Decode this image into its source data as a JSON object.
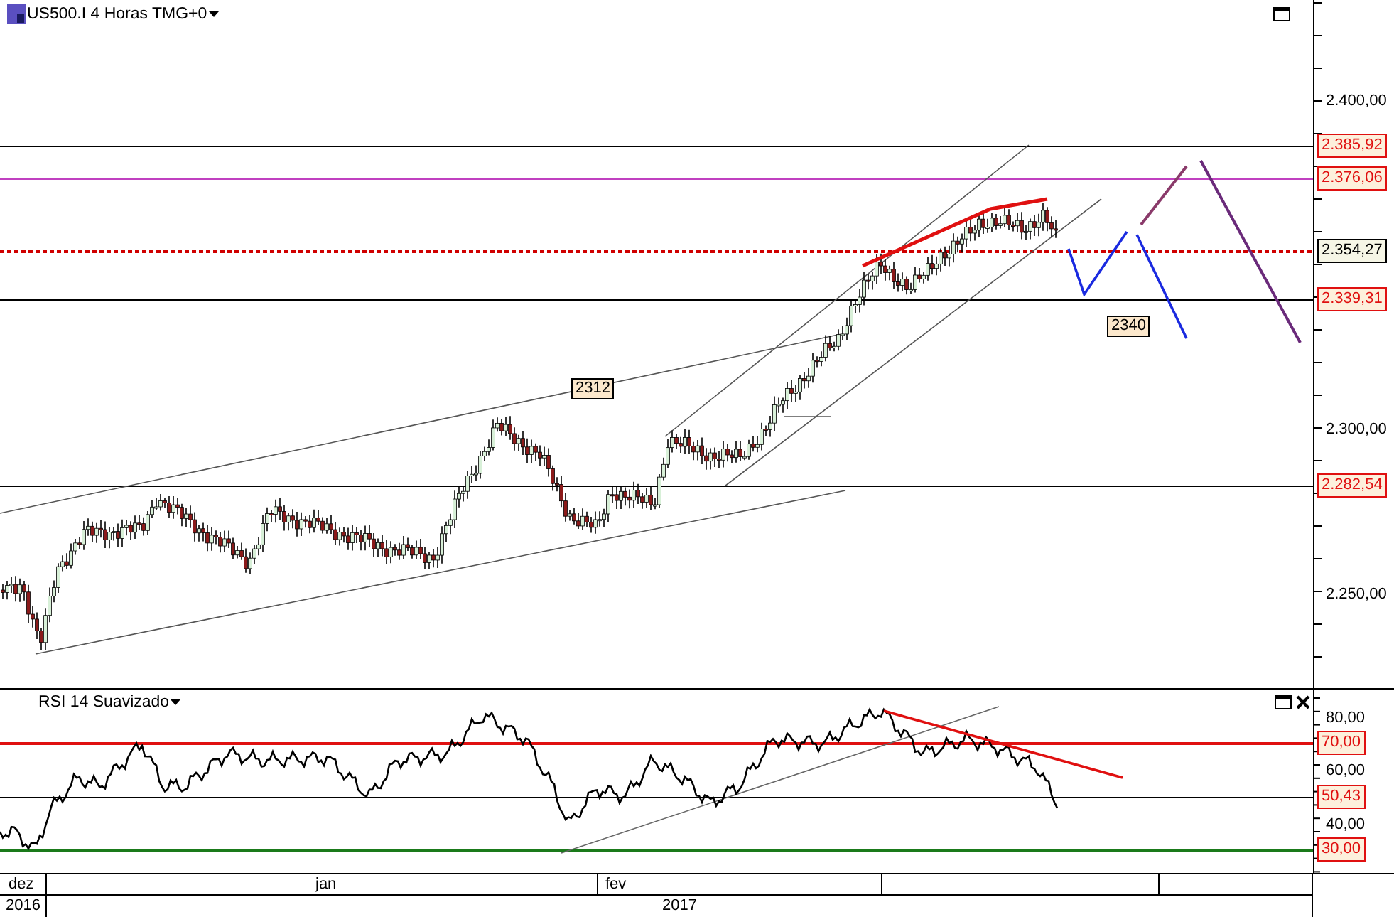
{
  "main_pane": {
    "title": "US500.I 4 Horas TMG+0",
    "price_ticks": [
      "2.400,00",
      "2.300,00",
      "2.250,00"
    ],
    "level_labels": [
      {
        "text": "2.385,92",
        "kind": "alert"
      },
      {
        "text": "2.376,06",
        "kind": "alert"
      },
      {
        "text": "2.354,27",
        "kind": "current"
      },
      {
        "text": "2.339,31",
        "kind": "alert"
      },
      {
        "text": "2.282,54",
        "kind": "alert"
      }
    ],
    "annotations": [
      "2312",
      "2340"
    ]
  },
  "rsi_pane": {
    "title": "RSI 14 Suavizado",
    "ticks": [
      "80,00",
      "60,00",
      "40,00"
    ],
    "level_labels": [
      {
        "text": "70,00",
        "kind": "alert"
      },
      {
        "text": "50,43",
        "kind": "alert"
      },
      {
        "text": "30,00",
        "kind": "alert"
      }
    ]
  },
  "time_axis": {
    "months": [
      "dez",
      "jan",
      "fev"
    ],
    "years": [
      "2016",
      "2017"
    ]
  }
}
